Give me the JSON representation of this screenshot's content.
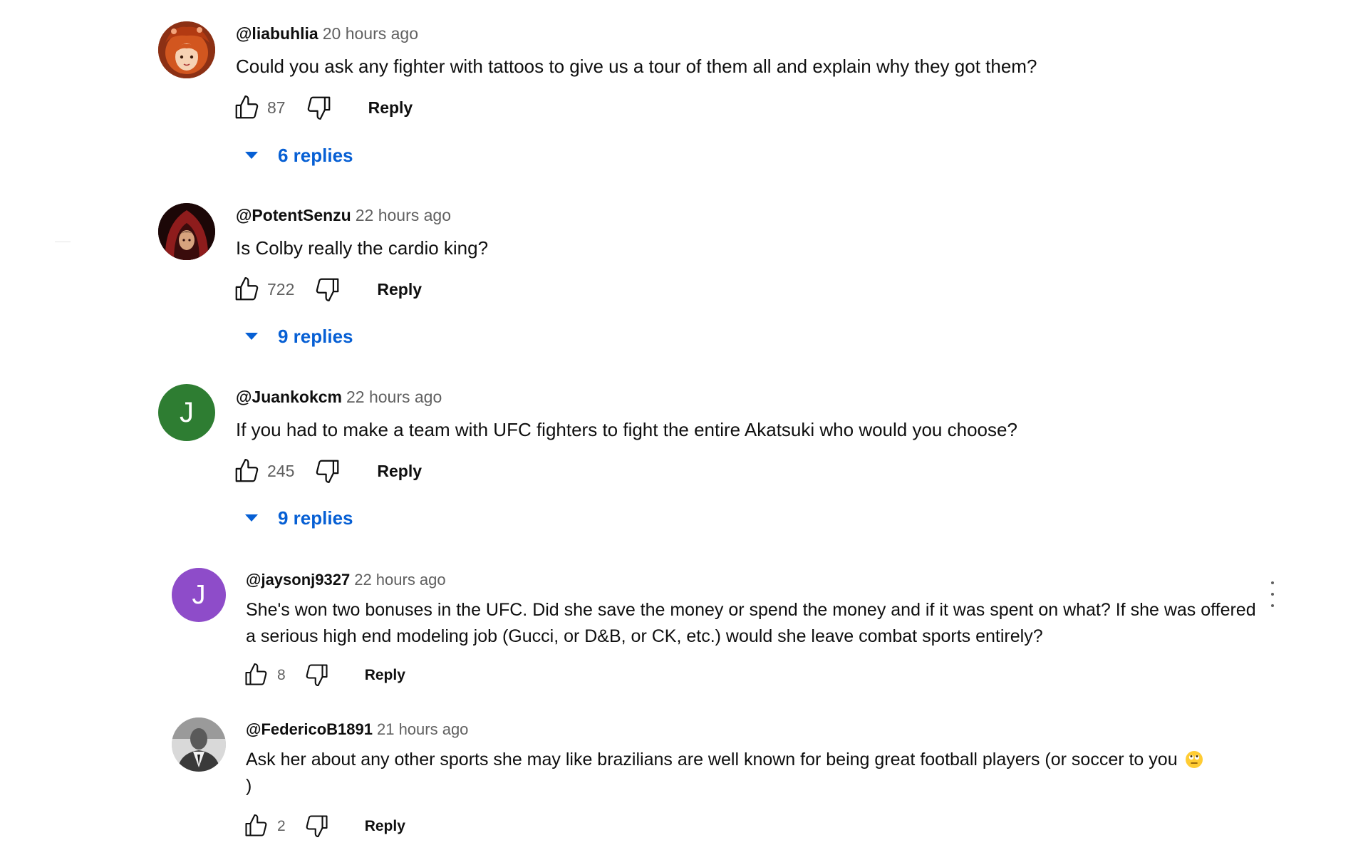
{
  "comments": [
    {
      "author": "@liabuhlia",
      "time": "20 hours ago",
      "text": "Could you ask any fighter with tattoos to give us a tour of them all and explain why they got them?",
      "likes": "87",
      "reply_label": "Reply",
      "replies_label": "6 replies",
      "avatar_icon": "red-haired-anime-avatar"
    },
    {
      "author": "@PotentSenzu",
      "time": "22 hours ago",
      "text": "Is Colby really the cardio king?",
      "likes": "722",
      "reply_label": "Reply",
      "replies_label": "9 replies",
      "avatar_icon": "red-hooded-figure-avatar"
    },
    {
      "author": "@Juankokcm",
      "time": "22 hours ago",
      "text": "If you had to make a team with UFC fighters to fight the entire Akatsuki who would you choose?",
      "likes": "245",
      "reply_label": "Reply",
      "replies_label": "9 replies",
      "avatar_letter": "J",
      "avatar_color": "#2e7d32"
    },
    {
      "author": "@jaysonj9327",
      "time": "22 hours ago",
      "text": "She's won two bonuses in the UFC.  Did she save the money or spend the money and if it was spent on what?  If she was offered a serious high end modeling job (Gucci, or D&B, or CK, etc.) would she leave combat sports entirely?",
      "likes": "8",
      "reply_label": "Reply",
      "avatar_letter": "J",
      "avatar_color": "#8e4cc9"
    },
    {
      "author": "@FedericoB1891",
      "time": "21 hours ago",
      "text": "Ask her about any other sports she may like brazilians are well known for being great football players (or soccer to you",
      "text_end": ")",
      "emoji_icon": "face-with-rolling-eyes-emoji",
      "likes": "2",
      "reply_label": "Reply",
      "avatar_icon": "grayscale-photo-avatar"
    }
  ],
  "colors": {
    "link_blue": "#065fd4",
    "secondary_text": "#606060",
    "primary_text": "#0f0f0f"
  },
  "icons": {
    "like": "thumbs-up-icon",
    "dislike": "thumbs-down-icon",
    "expand": "caret-down-icon",
    "menu": "more-vertical-icon"
  }
}
